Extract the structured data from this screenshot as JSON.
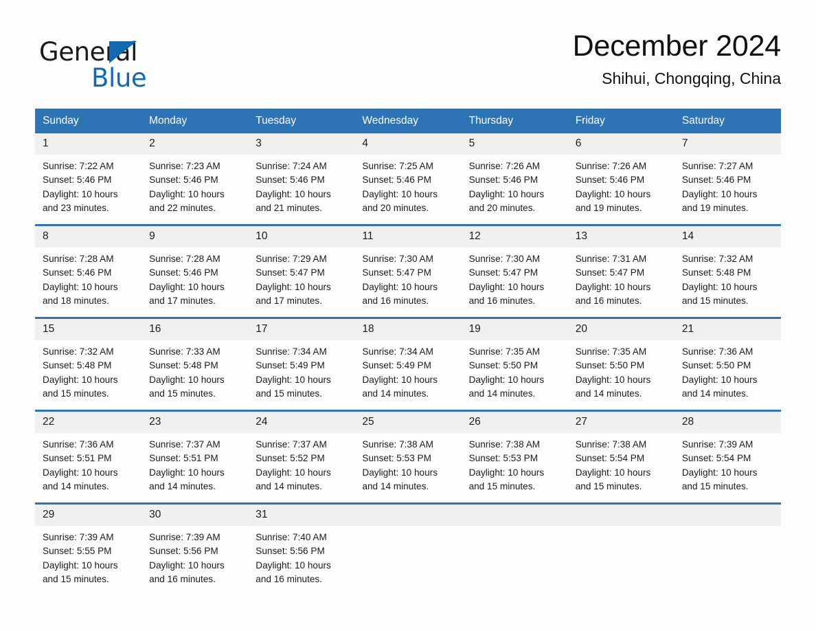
{
  "brand": {
    "name_part1": "General",
    "name_part2": "Blue",
    "logo_icon": "blue-triangle-logo"
  },
  "header": {
    "month_title": "December 2024",
    "location": "Shihui, Chongqing, China"
  },
  "colors": {
    "header_blue": "#2e74b5",
    "brand_blue": "#1268b3",
    "daynum_band": "#f0f0f0",
    "page_background": "#fdfdfd",
    "text": "#1b1b1b"
  },
  "calendar": {
    "weekday_headers": [
      "Sunday",
      "Monday",
      "Tuesday",
      "Wednesday",
      "Thursday",
      "Friday",
      "Saturday"
    ],
    "weeks": [
      [
        {
          "day": "1",
          "sunrise": "Sunrise: 7:22 AM",
          "sunset": "Sunset: 5:46 PM",
          "daylight_line1": "Daylight: 10 hours",
          "daylight_line2": "and 23 minutes."
        },
        {
          "day": "2",
          "sunrise": "Sunrise: 7:23 AM",
          "sunset": "Sunset: 5:46 PM",
          "daylight_line1": "Daylight: 10 hours",
          "daylight_line2": "and 22 minutes."
        },
        {
          "day": "3",
          "sunrise": "Sunrise: 7:24 AM",
          "sunset": "Sunset: 5:46 PM",
          "daylight_line1": "Daylight: 10 hours",
          "daylight_line2": "and 21 minutes."
        },
        {
          "day": "4",
          "sunrise": "Sunrise: 7:25 AM",
          "sunset": "Sunset: 5:46 PM",
          "daylight_line1": "Daylight: 10 hours",
          "daylight_line2": "and 20 minutes."
        },
        {
          "day": "5",
          "sunrise": "Sunrise: 7:26 AM",
          "sunset": "Sunset: 5:46 PM",
          "daylight_line1": "Daylight: 10 hours",
          "daylight_line2": "and 20 minutes."
        },
        {
          "day": "6",
          "sunrise": "Sunrise: 7:26 AM",
          "sunset": "Sunset: 5:46 PM",
          "daylight_line1": "Daylight: 10 hours",
          "daylight_line2": "and 19 minutes."
        },
        {
          "day": "7",
          "sunrise": "Sunrise: 7:27 AM",
          "sunset": "Sunset: 5:46 PM",
          "daylight_line1": "Daylight: 10 hours",
          "daylight_line2": "and 19 minutes."
        }
      ],
      [
        {
          "day": "8",
          "sunrise": "Sunrise: 7:28 AM",
          "sunset": "Sunset: 5:46 PM",
          "daylight_line1": "Daylight: 10 hours",
          "daylight_line2": "and 18 minutes."
        },
        {
          "day": "9",
          "sunrise": "Sunrise: 7:28 AM",
          "sunset": "Sunset: 5:46 PM",
          "daylight_line1": "Daylight: 10 hours",
          "daylight_line2": "and 17 minutes."
        },
        {
          "day": "10",
          "sunrise": "Sunrise: 7:29 AM",
          "sunset": "Sunset: 5:47 PM",
          "daylight_line1": "Daylight: 10 hours",
          "daylight_line2": "and 17 minutes."
        },
        {
          "day": "11",
          "sunrise": "Sunrise: 7:30 AM",
          "sunset": "Sunset: 5:47 PM",
          "daylight_line1": "Daylight: 10 hours",
          "daylight_line2": "and 16 minutes."
        },
        {
          "day": "12",
          "sunrise": "Sunrise: 7:30 AM",
          "sunset": "Sunset: 5:47 PM",
          "daylight_line1": "Daylight: 10 hours",
          "daylight_line2": "and 16 minutes."
        },
        {
          "day": "13",
          "sunrise": "Sunrise: 7:31 AM",
          "sunset": "Sunset: 5:47 PM",
          "daylight_line1": "Daylight: 10 hours",
          "daylight_line2": "and 16 minutes."
        },
        {
          "day": "14",
          "sunrise": "Sunrise: 7:32 AM",
          "sunset": "Sunset: 5:48 PM",
          "daylight_line1": "Daylight: 10 hours",
          "daylight_line2": "and 15 minutes."
        }
      ],
      [
        {
          "day": "15",
          "sunrise": "Sunrise: 7:32 AM",
          "sunset": "Sunset: 5:48 PM",
          "daylight_line1": "Daylight: 10 hours",
          "daylight_line2": "and 15 minutes."
        },
        {
          "day": "16",
          "sunrise": "Sunrise: 7:33 AM",
          "sunset": "Sunset: 5:48 PM",
          "daylight_line1": "Daylight: 10 hours",
          "daylight_line2": "and 15 minutes."
        },
        {
          "day": "17",
          "sunrise": "Sunrise: 7:34 AM",
          "sunset": "Sunset: 5:49 PM",
          "daylight_line1": "Daylight: 10 hours",
          "daylight_line2": "and 15 minutes."
        },
        {
          "day": "18",
          "sunrise": "Sunrise: 7:34 AM",
          "sunset": "Sunset: 5:49 PM",
          "daylight_line1": "Daylight: 10 hours",
          "daylight_line2": "and 14 minutes."
        },
        {
          "day": "19",
          "sunrise": "Sunrise: 7:35 AM",
          "sunset": "Sunset: 5:50 PM",
          "daylight_line1": "Daylight: 10 hours",
          "daylight_line2": "and 14 minutes."
        },
        {
          "day": "20",
          "sunrise": "Sunrise: 7:35 AM",
          "sunset": "Sunset: 5:50 PM",
          "daylight_line1": "Daylight: 10 hours",
          "daylight_line2": "and 14 minutes."
        },
        {
          "day": "21",
          "sunrise": "Sunrise: 7:36 AM",
          "sunset": "Sunset: 5:50 PM",
          "daylight_line1": "Daylight: 10 hours",
          "daylight_line2": "and 14 minutes."
        }
      ],
      [
        {
          "day": "22",
          "sunrise": "Sunrise: 7:36 AM",
          "sunset": "Sunset: 5:51 PM",
          "daylight_line1": "Daylight: 10 hours",
          "daylight_line2": "and 14 minutes."
        },
        {
          "day": "23",
          "sunrise": "Sunrise: 7:37 AM",
          "sunset": "Sunset: 5:51 PM",
          "daylight_line1": "Daylight: 10 hours",
          "daylight_line2": "and 14 minutes."
        },
        {
          "day": "24",
          "sunrise": "Sunrise: 7:37 AM",
          "sunset": "Sunset: 5:52 PM",
          "daylight_line1": "Daylight: 10 hours",
          "daylight_line2": "and 14 minutes."
        },
        {
          "day": "25",
          "sunrise": "Sunrise: 7:38 AM",
          "sunset": "Sunset: 5:53 PM",
          "daylight_line1": "Daylight: 10 hours",
          "daylight_line2": "and 14 minutes."
        },
        {
          "day": "26",
          "sunrise": "Sunrise: 7:38 AM",
          "sunset": "Sunset: 5:53 PM",
          "daylight_line1": "Daylight: 10 hours",
          "daylight_line2": "and 15 minutes."
        },
        {
          "day": "27",
          "sunrise": "Sunrise: 7:38 AM",
          "sunset": "Sunset: 5:54 PM",
          "daylight_line1": "Daylight: 10 hours",
          "daylight_line2": "and 15 minutes."
        },
        {
          "day": "28",
          "sunrise": "Sunrise: 7:39 AM",
          "sunset": "Sunset: 5:54 PM",
          "daylight_line1": "Daylight: 10 hours",
          "daylight_line2": "and 15 minutes."
        }
      ],
      [
        {
          "day": "29",
          "sunrise": "Sunrise: 7:39 AM",
          "sunset": "Sunset: 5:55 PM",
          "daylight_line1": "Daylight: 10 hours",
          "daylight_line2": "and 15 minutes."
        },
        {
          "day": "30",
          "sunrise": "Sunrise: 7:39 AM",
          "sunset": "Sunset: 5:56 PM",
          "daylight_line1": "Daylight: 10 hours",
          "daylight_line2": "and 16 minutes."
        },
        {
          "day": "31",
          "sunrise": "Sunrise: 7:40 AM",
          "sunset": "Sunset: 5:56 PM",
          "daylight_line1": "Daylight: 10 hours",
          "daylight_line2": "and 16 minutes."
        },
        {
          "day": "",
          "sunrise": "",
          "sunset": "",
          "daylight_line1": "",
          "daylight_line2": ""
        },
        {
          "day": "",
          "sunrise": "",
          "sunset": "",
          "daylight_line1": "",
          "daylight_line2": ""
        },
        {
          "day": "",
          "sunrise": "",
          "sunset": "",
          "daylight_line1": "",
          "daylight_line2": ""
        },
        {
          "day": "",
          "sunrise": "",
          "sunset": "",
          "daylight_line1": "",
          "daylight_line2": ""
        }
      ]
    ]
  }
}
